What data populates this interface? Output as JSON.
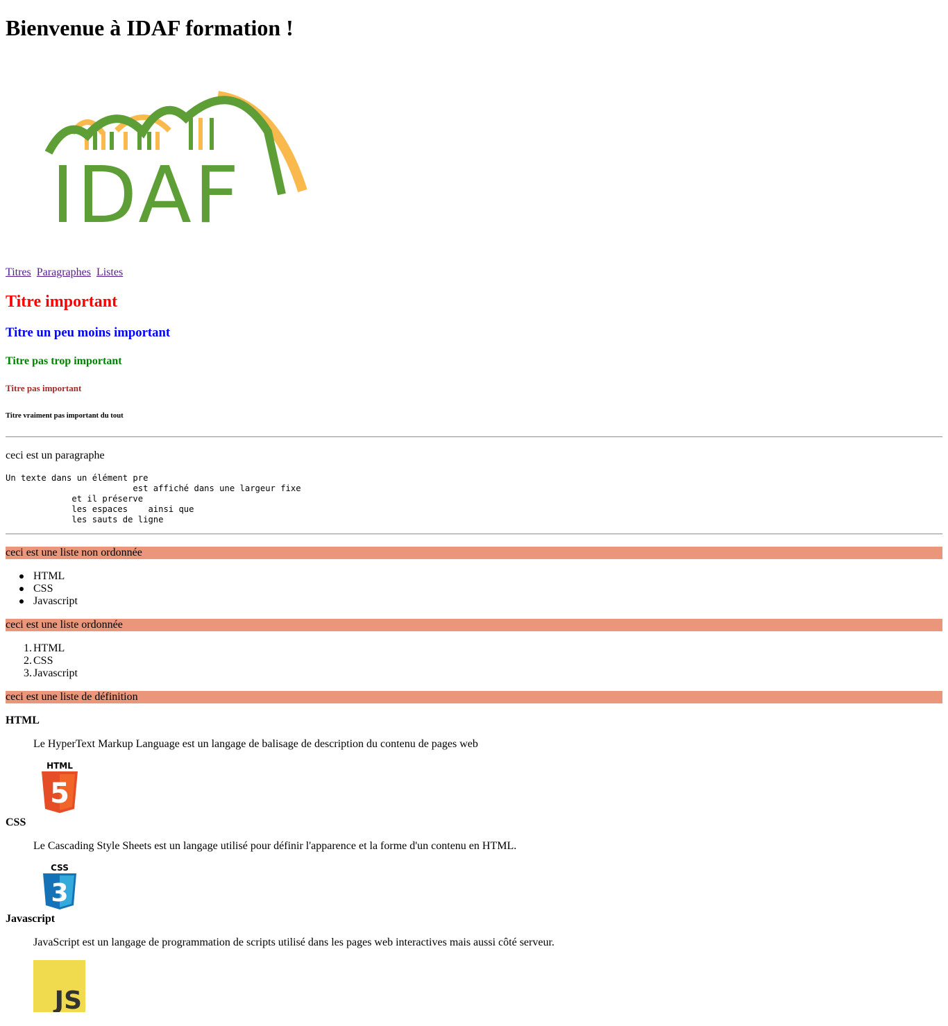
{
  "heading": "Bienvenue à IDAF formation !",
  "logo": {
    "text": "IDAF",
    "green": "#5e9e36",
    "orange": "#f9b94c"
  },
  "nav": [
    "Titres",
    "Paragraphes",
    "Listes"
  ],
  "titles": {
    "h1": "Titre important",
    "h2": "Titre un peu moins important",
    "h3": "Titre pas trop important",
    "h4": "Titre pas important",
    "h5": "Titre vraiment pas important du tout"
  },
  "paragraph": "ceci est un paragraphe",
  "pre_text": "Un texte dans un élément pre\n                         est affiché dans une largeur fixe\n             et il préserve\n             les espaces    ainsi que\n             les sauts de ligne",
  "sections": {
    "unordered": "ceci est une liste non ordonnée",
    "ordered": "ceci est une liste ordonnée",
    "definition": "ceci est une liste de définition"
  },
  "banner_color": "#e9967a",
  "unordered_items": [
    "HTML",
    "CSS",
    "Javascript"
  ],
  "ordered_items": [
    "HTML",
    "CSS",
    "Javascript"
  ],
  "definitions": [
    {
      "term": "HTML",
      "description": "Le HyperText Markup Language est un langage de balisage de description du contenu de pages web",
      "badge": "HTML",
      "digit": "5",
      "color": "#e44d26"
    },
    {
      "term": "CSS",
      "description": "Le Cascading Style Sheets est un langage utilisé pour définir l'apparence et la forme d'un contenu en HTML.",
      "badge": "CSS",
      "digit": "3",
      "color": "#1572b6"
    },
    {
      "term": "Javascript",
      "description": "JavaScript est un langage de programmation de scripts utilisé dans les pages web interactives mais aussi côté serveur.",
      "badge": "JS",
      "color": "#f0db4f"
    }
  ]
}
